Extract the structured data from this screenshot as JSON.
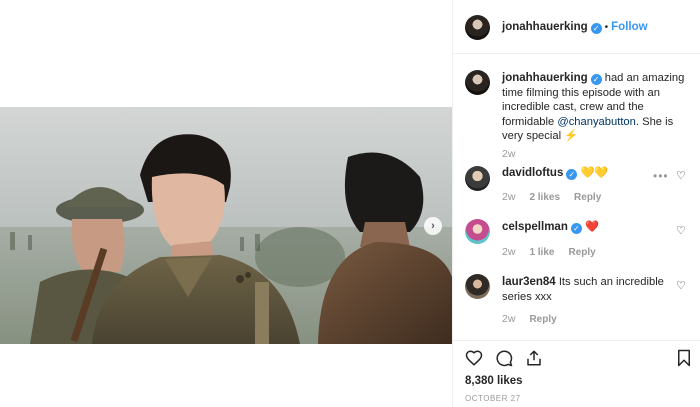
{
  "post": {
    "username": "jonahhauerking",
    "follow_label": "Follow",
    "separator": "•",
    "verified_mark": "✓"
  },
  "caption": {
    "username": "jonahhauerking",
    "text_before": " had an amazing time filming this episode with an incredible cast, crew and the formidable ",
    "mention": "@chanyabutton",
    "text_after": ". She is very special ",
    "emoji": "⚡",
    "time": "2w"
  },
  "comments": [
    {
      "username": "davidloftus",
      "text": "💛💛",
      "time": "2w",
      "likes": "2 likes",
      "reply": "Reply",
      "more": "•••"
    },
    {
      "username": "celspellman",
      "text": "❤️",
      "time": "2w",
      "likes": "1 like",
      "reply": "Reply"
    },
    {
      "username": "laur3en84",
      "text": "Its such an incredible series xxx",
      "time": "2w",
      "reply": "Reply"
    }
  ],
  "heart_icon_glyph": "♡",
  "media": {
    "next_glyph": "›"
  },
  "footer": {
    "likes_count": "8,380 likes",
    "date": "OCTOBER 27"
  }
}
